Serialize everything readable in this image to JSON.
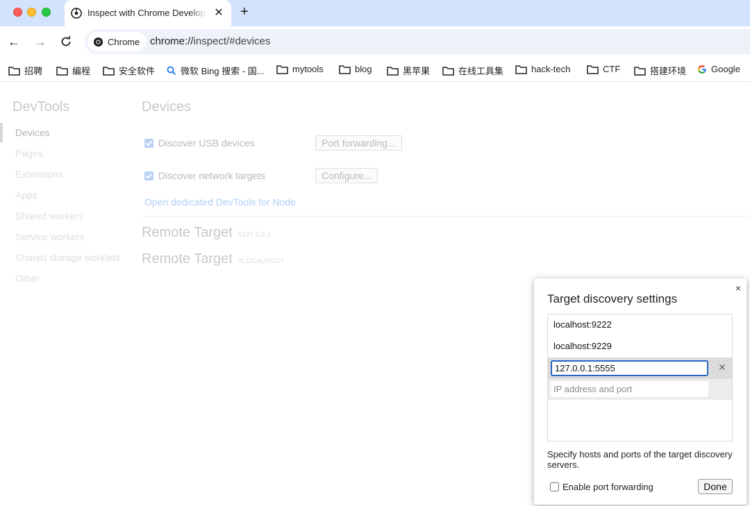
{
  "browser": {
    "tab_title": "Inspect with Chrome Developer Tools",
    "new_tab_glyph": "+",
    "tab_close_glyph": "✕",
    "chip_label": "Chrome",
    "url_host": "chrome://",
    "url_path": "inspect/#devices"
  },
  "bookmarks": [
    {
      "label": "招聘",
      "icon": "folder-icon"
    },
    {
      "label": "编程",
      "icon": "folder-icon"
    },
    {
      "label": "安全软件",
      "icon": "folder-icon"
    },
    {
      "label": "微软 Bing 搜索 - 国...",
      "icon": "search-icon"
    },
    {
      "label": "mytools",
      "icon": "folder-icon"
    },
    {
      "label": "blog",
      "icon": "folder-icon"
    },
    {
      "label": "黑苹果",
      "icon": "folder-icon"
    },
    {
      "label": "在线工具集",
      "icon": "folder-icon"
    },
    {
      "label": "hack-tech",
      "icon": "folder-icon"
    },
    {
      "label": "CTF",
      "icon": "folder-icon"
    },
    {
      "label": "搭建环境",
      "icon": "folder-icon"
    },
    {
      "label": "Google",
      "icon": "google-icon"
    }
  ],
  "sidebar": {
    "title": "DevTools",
    "items": [
      "Devices",
      "Pages",
      "Extensions",
      "Apps",
      "Shared workers",
      "Service workers",
      "Shared storage worklets",
      "Other"
    ]
  },
  "main": {
    "title": "Devices",
    "discover_usb": "Discover USB devices",
    "port_forwarding_btn": "Port forwarding...",
    "discover_network": "Discover network targets",
    "configure_btn": "Configure...",
    "node_link": "Open dedicated DevTools for Node",
    "remote_targets": [
      {
        "name": "Remote Target",
        "sub": "#127.0.0.1"
      },
      {
        "name": "Remote Target",
        "sub": "#LOCALHOST"
      }
    ]
  },
  "dialog": {
    "title": "Target discovery settings",
    "close_glyph": "×",
    "targets": [
      "localhost:9222",
      "localhost:9229"
    ],
    "editing_value": "127.0.0.1:5555",
    "delete_glyph": "✕",
    "new_placeholder": "IP address and port",
    "help_text": "Specify hosts and ports of the target discovery servers.",
    "enable_port_forwarding": "Enable port forwarding",
    "done_label": "Done"
  },
  "colors": {
    "titlebar": "#d3e3fd",
    "accent": "#2766c4",
    "link": "#1a73e8"
  }
}
